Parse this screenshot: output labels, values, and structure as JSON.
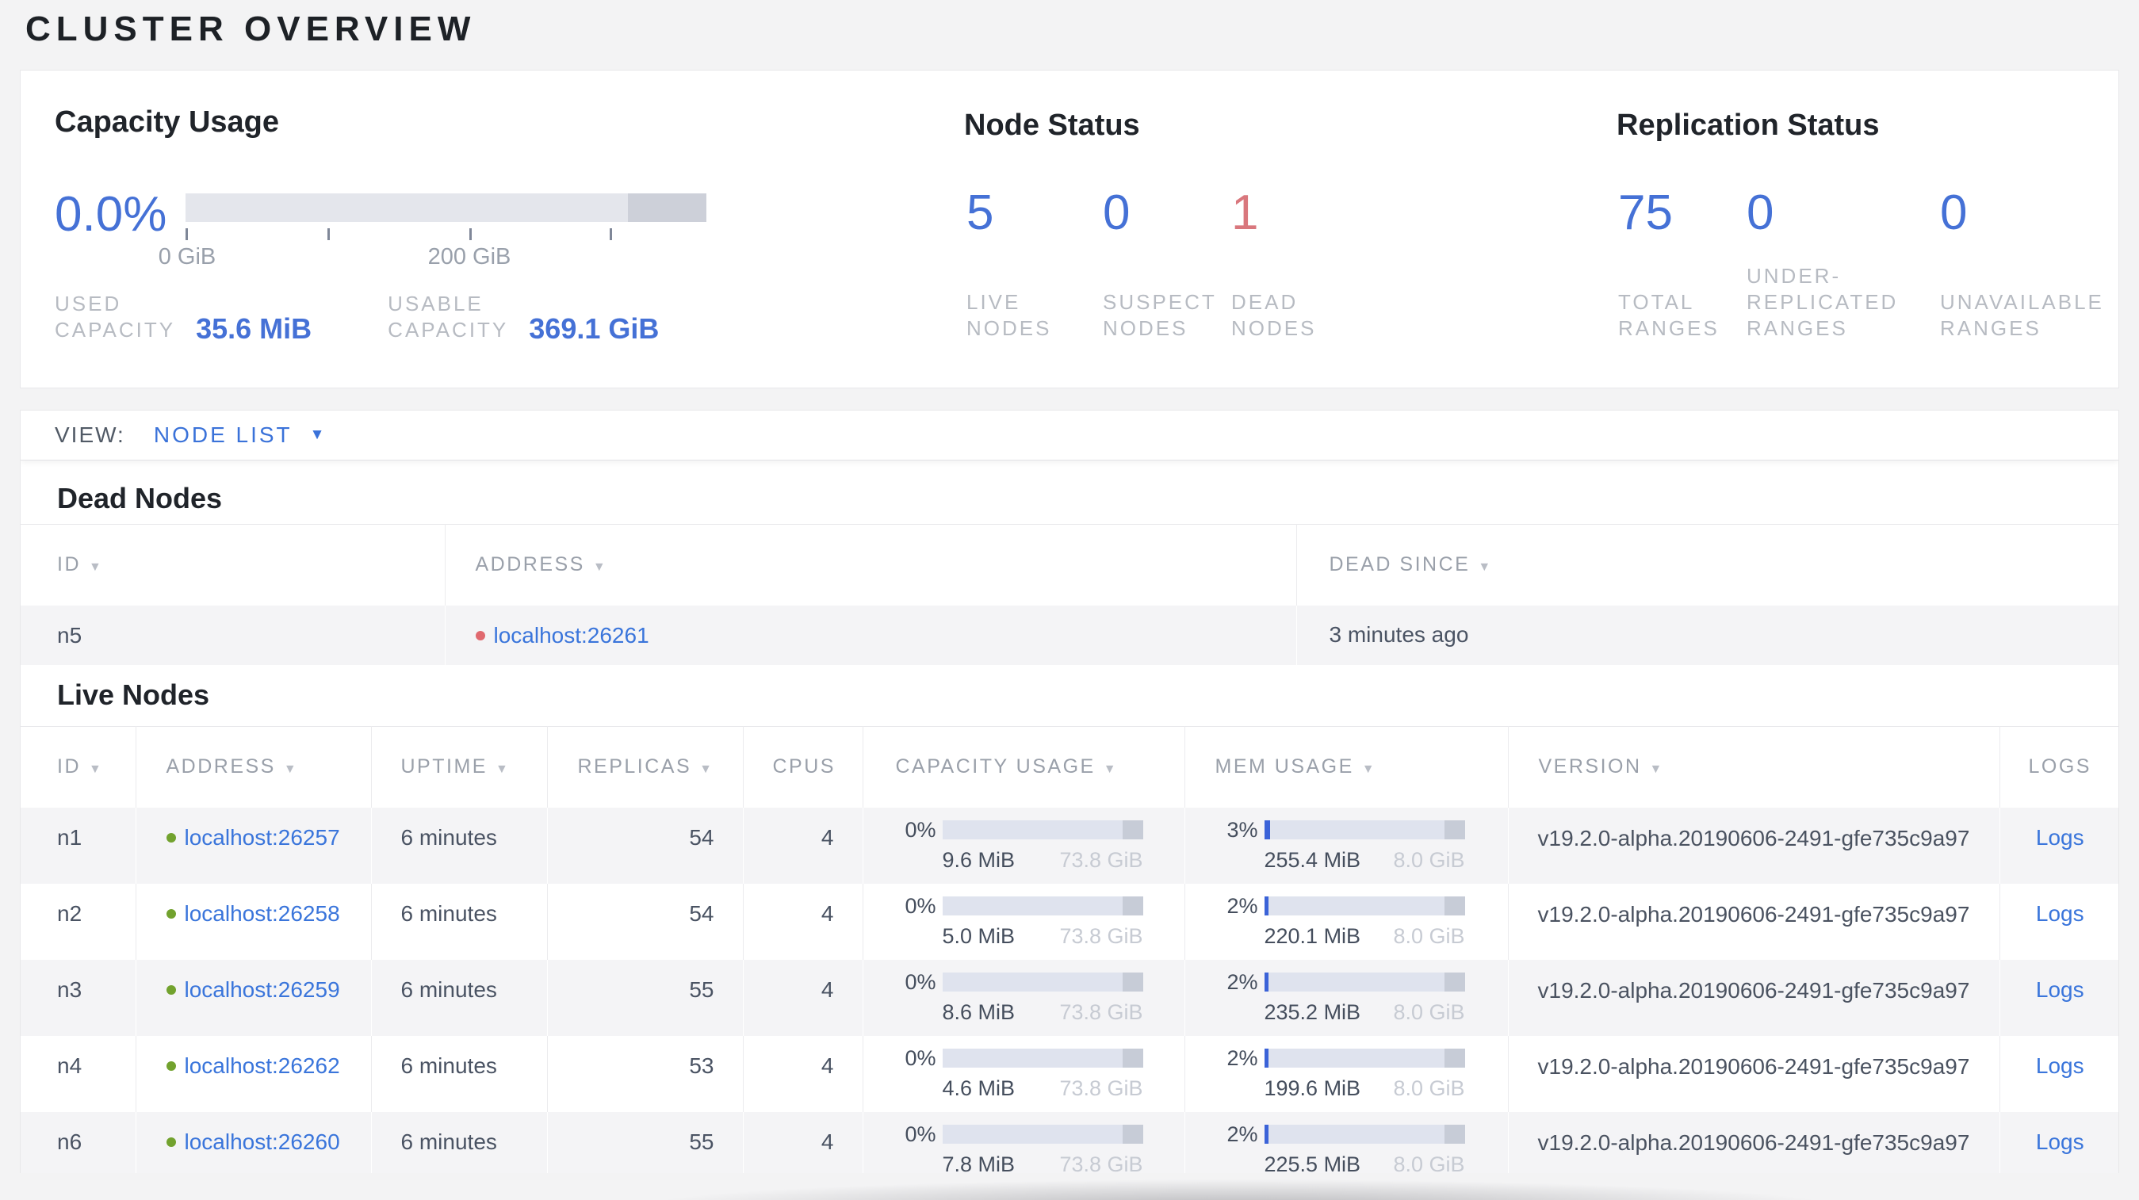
{
  "page": {
    "title": "CLUSTER OVERVIEW"
  },
  "icons": {
    "sort_arrow": "▼",
    "dropdown_arrow": "▼"
  },
  "colors": {
    "accent_blue": "#4571d6",
    "link_blue": "#3a75db",
    "danger_red": "#d9777d",
    "live_dot_green": "#72a22e",
    "dead_dot_red": "#e0696f",
    "bar_bg": "#dfe3ee",
    "bar_dark_segment": "#c7ccd7",
    "bar_fill_blue": "#3b63d8",
    "label_gray": "#b7bbc2"
  },
  "summary": {
    "capacity": {
      "title": "Capacity Usage",
      "percent": "0.0%",
      "tick_labels": [
        "0 GiB",
        "200 GiB"
      ],
      "used": {
        "label_line1": "USED",
        "label_line2": "CAPACITY",
        "value": "35.6 MiB"
      },
      "usable": {
        "label_line1": "USABLE",
        "label_line2": "CAPACITY",
        "value": "369.1 GiB"
      }
    },
    "node_status": {
      "title": "Node Status",
      "stats": [
        {
          "value": "5",
          "label_line1": "LIVE",
          "label_line2": "NODES"
        },
        {
          "value": "0",
          "label_line1": "SUSPECT",
          "label_line2": "NODES"
        },
        {
          "value": "1",
          "label_line1": "DEAD",
          "label_line2": "NODES"
        }
      ]
    },
    "replication_status": {
      "title": "Replication Status",
      "stats": [
        {
          "value": "75",
          "label_line1": "TOTAL",
          "label_line2": "RANGES"
        },
        {
          "value": "0",
          "label_line1": "UNDER-",
          "label_line2": "REPLICATED",
          "label_line3": "RANGES"
        },
        {
          "value": "0",
          "label_line1": "UNAVAILABLE",
          "label_line2": "RANGES"
        }
      ]
    }
  },
  "view_bar": {
    "label": "VIEW:",
    "selected": "NODE LIST"
  },
  "dead_nodes": {
    "heading": "Dead Nodes",
    "columns": [
      "ID",
      "ADDRESS",
      "DEAD SINCE"
    ],
    "rows": [
      {
        "id": "n5",
        "address": "localhost:26261",
        "dead_since": "3 minutes ago"
      }
    ]
  },
  "live_nodes": {
    "heading": "Live Nodes",
    "columns": [
      "ID",
      "ADDRESS",
      "UPTIME",
      "REPLICAS",
      "CPUS",
      "CAPACITY USAGE",
      "MEM USAGE",
      "VERSION",
      "LOGS"
    ],
    "rows": [
      {
        "id": "n1",
        "address": "localhost:26257",
        "uptime": "6 minutes",
        "replicas": "54",
        "cpus": "4",
        "capacity_percent": "0%",
        "capacity_used": "9.6 MiB",
        "capacity_total": "73.8 GiB",
        "mem_percent": "3%",
        "mem_used": "255.4 MiB",
        "mem_total": "8.0 GiB",
        "version": "v19.2.0-alpha.20190606-2491-gfe735c9a97",
        "logs_label": "Logs"
      },
      {
        "id": "n2",
        "address": "localhost:26258",
        "uptime": "6 minutes",
        "replicas": "54",
        "cpus": "4",
        "capacity_percent": "0%",
        "capacity_used": "5.0 MiB",
        "capacity_total": "73.8 GiB",
        "mem_percent": "2%",
        "mem_used": "220.1 MiB",
        "mem_total": "8.0 GiB",
        "version": "v19.2.0-alpha.20190606-2491-gfe735c9a97",
        "logs_label": "Logs"
      },
      {
        "id": "n3",
        "address": "localhost:26259",
        "uptime": "6 minutes",
        "replicas": "55",
        "cpus": "4",
        "capacity_percent": "0%",
        "capacity_used": "8.6 MiB",
        "capacity_total": "73.8 GiB",
        "mem_percent": "2%",
        "mem_used": "235.2 MiB",
        "mem_total": "8.0 GiB",
        "version": "v19.2.0-alpha.20190606-2491-gfe735c9a97",
        "logs_label": "Logs"
      },
      {
        "id": "n4",
        "address": "localhost:26262",
        "uptime": "6 minutes",
        "replicas": "53",
        "cpus": "4",
        "capacity_percent": "0%",
        "capacity_used": "4.6 MiB",
        "capacity_total": "73.8 GiB",
        "mem_percent": "2%",
        "mem_used": "199.6 MiB",
        "mem_total": "8.0 GiB",
        "version": "v19.2.0-alpha.20190606-2491-gfe735c9a97",
        "logs_label": "Logs"
      },
      {
        "id": "n6",
        "address": "localhost:26260",
        "uptime": "6 minutes",
        "replicas": "55",
        "cpus": "4",
        "capacity_percent": "0%",
        "capacity_used": "7.8 MiB",
        "capacity_total": "73.8 GiB",
        "mem_percent": "2%",
        "mem_used": "225.5 MiB",
        "mem_total": "8.0 GiB",
        "version": "v19.2.0-alpha.20190606-2491-gfe735c9a97",
        "logs_label": "Logs"
      }
    ]
  }
}
